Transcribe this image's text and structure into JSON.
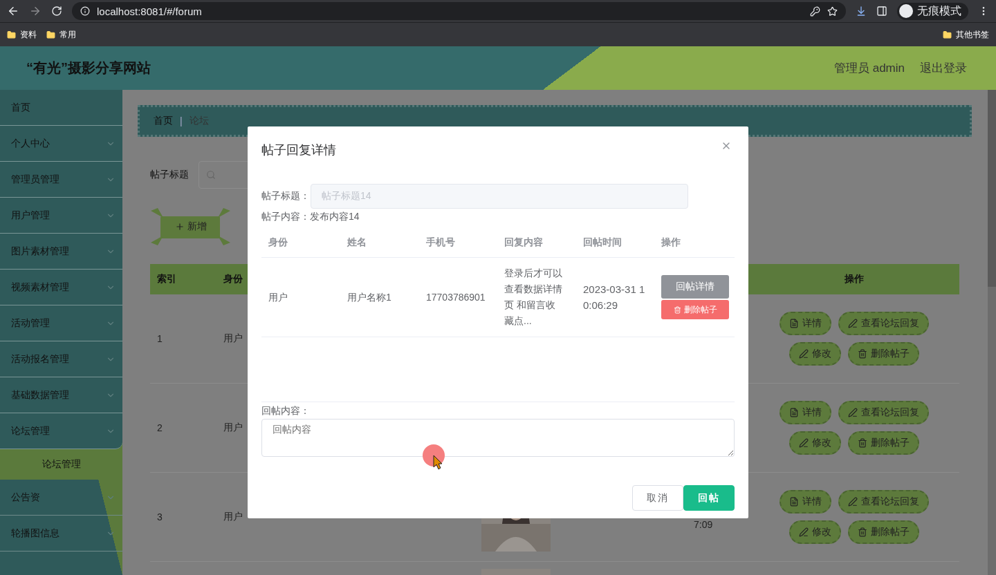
{
  "browser": {
    "url": "localhost:8081/#/forum",
    "profile_label": "无痕模式",
    "bookmarks": [
      "资料",
      "常用"
    ],
    "other_bookmarks": "其他书签"
  },
  "header": {
    "title": "“有光”摄影分享网站",
    "user": "管理员 admin",
    "logout": "退出登录"
  },
  "sidebar": {
    "items": [
      {
        "label": "首页",
        "kind": "link"
      },
      {
        "label": "个人中心",
        "kind": "menu",
        "expanded": false
      },
      {
        "label": "管理员管理",
        "kind": "menu",
        "expanded": false
      },
      {
        "label": "用户管理",
        "kind": "menu",
        "expanded": false
      },
      {
        "label": "图片素材管理",
        "kind": "menu",
        "expanded": false
      },
      {
        "label": "视频素材管理",
        "kind": "menu",
        "expanded": false
      },
      {
        "label": "活动管理",
        "kind": "menu",
        "expanded": false
      },
      {
        "label": "活动报名管理",
        "kind": "menu",
        "expanded": false
      },
      {
        "label": "基础数据管理",
        "kind": "menu",
        "expanded": false
      },
      {
        "label": "论坛管理",
        "kind": "menu",
        "expanded": true,
        "children": [
          {
            "label": "论坛管理",
            "selected": true
          }
        ]
      },
      {
        "label": "公告资",
        "kind": "menu",
        "expanded": false
      },
      {
        "label": "轮播图信息",
        "kind": "menu",
        "expanded": false
      }
    ]
  },
  "breadcrumb": {
    "items": [
      "首页",
      "论坛"
    ],
    "separator": "|"
  },
  "search": {
    "label": "帖子标题"
  },
  "add_button": "新增",
  "table": {
    "columns": [
      "索引",
      "身份",
      "操作"
    ],
    "rows": [
      {
        "index": "1",
        "role": "用户",
        "actions": [
          {
            "label": "详情",
            "kind": "detail"
          },
          {
            "label": "查看论坛回复",
            "kind": "replies"
          },
          {
            "label": "修改",
            "kind": "edit"
          },
          {
            "label": "删除帖子",
            "kind": "delete"
          }
        ]
      },
      {
        "index": "2",
        "role": "用户",
        "actions": [
          {
            "label": "详情",
            "kind": "detail"
          },
          {
            "label": "查看论坛回复",
            "kind": "replies"
          },
          {
            "label": "修改",
            "kind": "edit"
          },
          {
            "label": "删除帖子",
            "kind": "delete"
          }
        ]
      },
      {
        "index": "3",
        "role": "用户",
        "picture": {
          "kind": "picture"
        },
        "time": "7:09",
        "actions": [
          {
            "label": "详情",
            "kind": "detail"
          },
          {
            "label": "查看论坛回复",
            "kind": "replies"
          },
          {
            "label": "修改",
            "kind": "edit"
          },
          {
            "label": "删除帖子",
            "kind": "delete"
          }
        ]
      },
      {
        "picture": {
          "kind": "picture"
        }
      }
    ]
  },
  "dialog": {
    "title": "帖子回复详情",
    "title_label": "帖子标题：",
    "title_value": "帖子标题14",
    "content_line": "帖子内容：发布内容14",
    "table": {
      "columns": [
        "身份",
        "姓名",
        "手机号",
        "回复内容",
        "回帖时间",
        "操作"
      ],
      "rows": [
        {
          "role": "用户",
          "name": "用户名称1",
          "phone": "17703786901",
          "content": "登录后才可以查看数据详情页 和留言收藏点...",
          "time": "2023-03-31 10:06:29",
          "actions": [
            {
              "label": "回帖详情",
              "kind": "detail"
            },
            {
              "label": "删除帖子",
              "kind": "delete"
            }
          ]
        }
      ]
    },
    "reply_label": "回帖内容：",
    "reply_placeholder": "回帖内容",
    "buttons": [
      {
        "label": "取消",
        "kind": "cancel"
      },
      {
        "label": "回帖",
        "kind": "primary"
      }
    ]
  }
}
